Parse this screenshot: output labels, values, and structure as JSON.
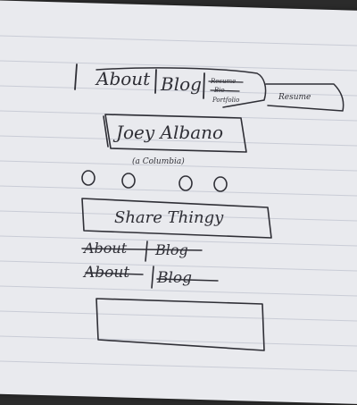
{
  "sketch": {
    "nav_top": {
      "about": "About",
      "blog": "Blog",
      "stack_1": "Resume",
      "stack_2": "Bio",
      "stack_3": "Portfolio",
      "resume": "Resume"
    },
    "name": "Joey Albano",
    "subtitle": "(a Columbia)",
    "circle_count": 4,
    "share_label": "Share Thingy",
    "crossed_nav_1": {
      "about": "About",
      "blog": "Blog"
    },
    "crossed_nav_2": {
      "about": "About",
      "blog": "Blog"
    },
    "empty_box": ""
  }
}
